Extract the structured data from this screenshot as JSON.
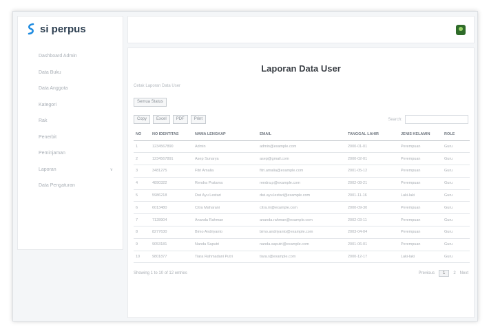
{
  "app": {
    "brand": "si perpus"
  },
  "sidebar": {
    "items": [
      {
        "label": "Dashboard Admin"
      },
      {
        "label": "Data Buku"
      },
      {
        "label": "Data Anggota"
      },
      {
        "label": "Kategori"
      },
      {
        "label": "Rak"
      },
      {
        "label": "Penerbit"
      },
      {
        "label": "Peminjaman"
      },
      {
        "label": "Laporan",
        "has_children": true
      },
      {
        "label": "Data Pengaturan"
      }
    ]
  },
  "main": {
    "title": "Laporan Data User",
    "filter_label": "Cetak Laporan Data User",
    "filter_button": "Semua Status",
    "export_buttons": [
      "Copy",
      "Excel",
      "PDF",
      "Print"
    ],
    "search_label": "Search:",
    "search_placeholder": "",
    "table": {
      "headers": [
        "NO",
        "NO IDENTITAS",
        "NAMA LENGKAP",
        "EMAIL",
        "TANGGAL LAHIR",
        "JENIS KELAMIN",
        "ROLE"
      ],
      "rows": [
        [
          "1",
          "1234567890",
          "Admin",
          "admin@example.com",
          "2000-01-01",
          "Perempuan",
          "Guru"
        ],
        [
          "2",
          "1234567891",
          "Asep Sunarya",
          "asep@gmail.com",
          "2000-02-01",
          "Perempuan",
          "Guru"
        ],
        [
          "3",
          "3481275",
          "Fitri Amalia",
          "fitri.amalia@example.com",
          "2001-05-12",
          "Perempuan",
          "Guru"
        ],
        [
          "4",
          "4890322",
          "Rendra Pratama",
          "rendra.p@example.com",
          "2002-08-21",
          "Perempuan",
          "Guru"
        ],
        [
          "5",
          "5986218",
          "Dwi Ayu Lestari",
          "dwi.ayu.lestari@example.com",
          "2001-11-16",
          "Laki-laki",
          "Guru"
        ],
        [
          "6",
          "6013480",
          "Citra Maharani",
          "citra.m@example.com",
          "2000-09-30",
          "Perempuan",
          "Guru"
        ],
        [
          "7",
          "7128904",
          "Ananda Rahman",
          "ananda.rahman@example.com",
          "2002-03-11",
          "Perempuan",
          "Guru"
        ],
        [
          "8",
          "8277630",
          "Bimo Andriyanto",
          "bimo.andriyanto@example.com",
          "2003-04-04",
          "Perempuan",
          "Guru"
        ],
        [
          "9",
          "9053181",
          "Nanda Saputri",
          "nanda.saputri@example.com",
          "2001-06-01",
          "Perempuan",
          "Guru"
        ],
        [
          "10",
          "9801877",
          "Tiara Rahmadani Putri",
          "tiara.r@example.com",
          "2000-12-17",
          "Laki-laki",
          "Guru"
        ]
      ]
    },
    "info": "Showing 1 to 10 of 12 entries",
    "pagination": {
      "previous": "Previous",
      "current": "1",
      "next_page": "2",
      "next": "Next"
    }
  }
}
